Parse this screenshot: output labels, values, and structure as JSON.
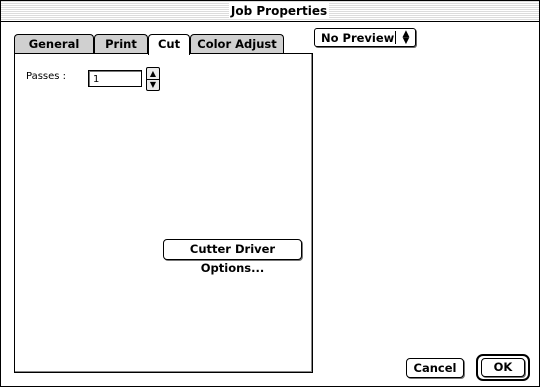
{
  "window": {
    "title": "Job Properties"
  },
  "tabs": [
    {
      "label": "General",
      "active": false
    },
    {
      "label": "Print",
      "active": false
    },
    {
      "label": "Cut",
      "active": true
    },
    {
      "label": "Color Adjust",
      "active": false
    }
  ],
  "cut_panel": {
    "passes_label": "Passes :",
    "passes_value": "1",
    "cutter_button": "Cutter Driver Options..."
  },
  "preview": {
    "selected": "No Preview",
    "arrows_icon": "up-down-arrows"
  },
  "buttons": {
    "cancel": "Cancel",
    "ok": "OK"
  }
}
